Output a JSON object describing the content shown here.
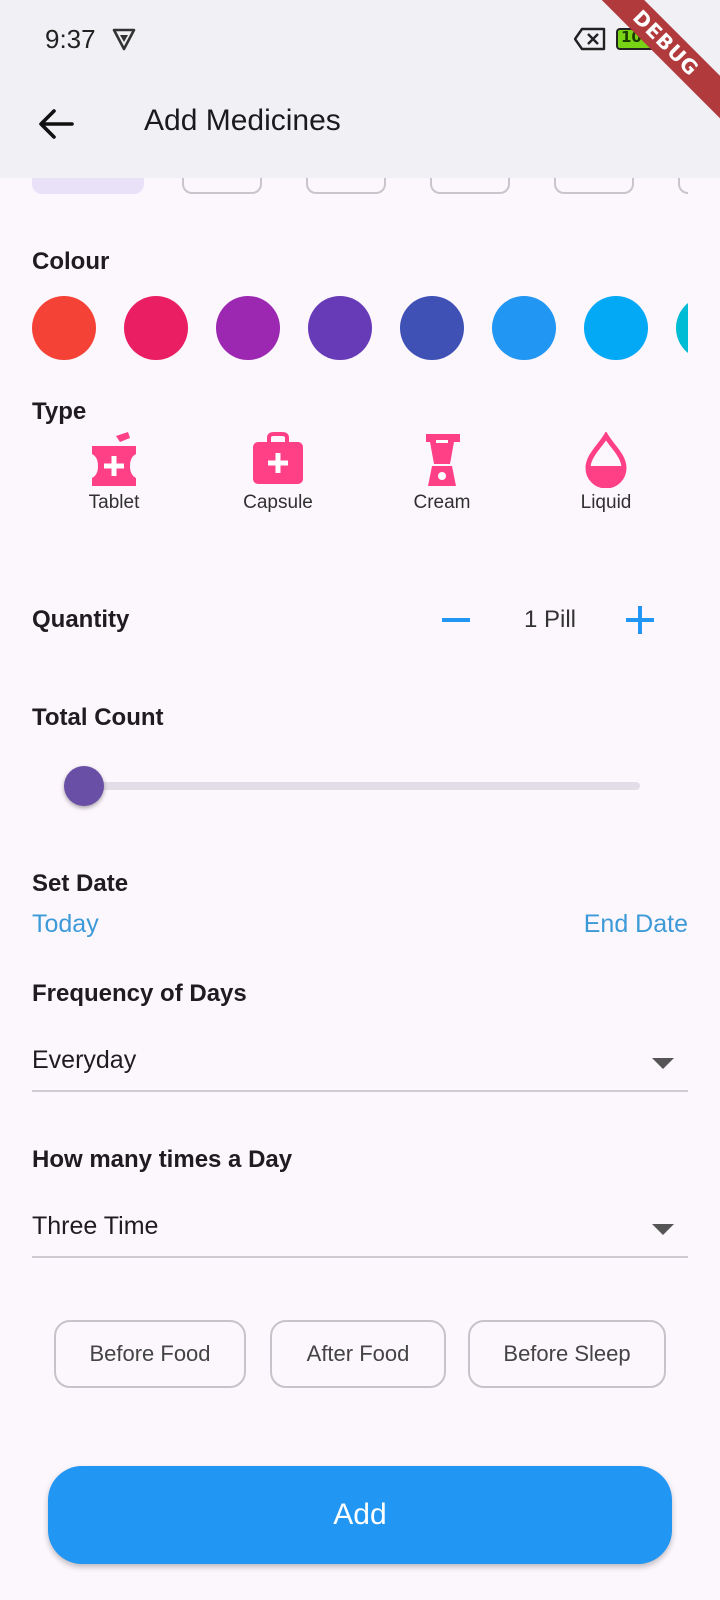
{
  "status_bar": {
    "time": "9:37",
    "battery": "100",
    "debug_label": "DEBUG"
  },
  "app_bar": {
    "title": "Add Medicines",
    "back_icon": "arrow-left-icon"
  },
  "colour_section": {
    "label": "Colour",
    "swatches": [
      "#f44336",
      "#e91e63",
      "#9c27b0",
      "#673ab7",
      "#3f51b5",
      "#2196f3",
      "#03a9f4",
      "#00bcd4"
    ]
  },
  "type_section": {
    "label": "Type",
    "items": [
      {
        "label": "Tablet",
        "icon": "mortar-pestle-icon"
      },
      {
        "label": "Capsule",
        "icon": "medical-kit-icon"
      },
      {
        "label": "Cream",
        "icon": "blender-icon"
      },
      {
        "label": "Liquid",
        "icon": "drop-icon"
      }
    ],
    "icon_color": "#ff3f86"
  },
  "quantity": {
    "label": "Quantity",
    "value": "1 Pill",
    "accent": "#2196f3"
  },
  "total_count": {
    "label": "Total Count",
    "slider_fraction": 0
  },
  "set_date": {
    "label": "Set Date",
    "start": "Today",
    "end": "End Date"
  },
  "frequency": {
    "label": "Frequency of Days",
    "value": "Everyday"
  },
  "times_per_day": {
    "label": "How many times a Day",
    "value": "Three Time"
  },
  "timing_options": [
    "Before Food",
    "After Food",
    "Before Sleep"
  ],
  "submit": {
    "label": "Add"
  }
}
